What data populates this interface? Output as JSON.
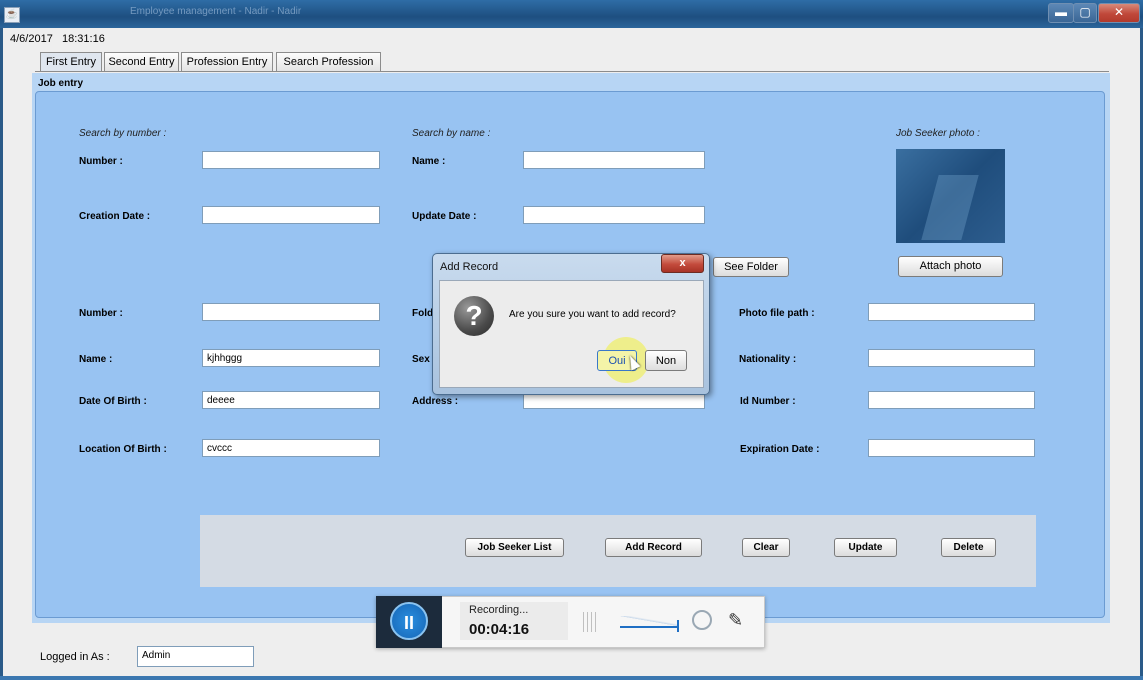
{
  "window": {
    "title": "Employee management - Nadir - Nadir",
    "controls": {
      "minimize": "▬",
      "maximize": "▢",
      "close": "✕"
    }
  },
  "status": {
    "datetime": "4/6/2017   18:31:16"
  },
  "tabs": [
    {
      "label": "First Entry",
      "active": true
    },
    {
      "label": "Second Entry",
      "active": false
    },
    {
      "label": "Profession Entry",
      "active": false
    },
    {
      "label": "Search Profession",
      "active": false
    }
  ],
  "panel": {
    "title": "Job entry"
  },
  "sections": {
    "by_number": "Search by number :",
    "by_name": "Search by name :",
    "photo": "Job Seeker photo :"
  },
  "labels": {
    "number_search": "Number :",
    "name_search": "Name :",
    "creation_date": "Creation Date :",
    "update_date": "Update Date :",
    "number": "Number :",
    "folder": "Fold",
    "photo_path": "Photo file path :",
    "name": "Name :",
    "sex": "Sex",
    "nationality": "Nationality :",
    "dob": "Date Of Birth :",
    "address": "Address :",
    "id_number": "Id Number :",
    "location_birth": "Location Of Birth :",
    "expiration": "Expiration Date :"
  },
  "fields": {
    "number_search": "",
    "name_search": "",
    "creation_date": "",
    "update_date": "",
    "number": "",
    "photo_path": "",
    "name": "kjhhggg",
    "nationality": "",
    "dob": "deeee",
    "address": "",
    "id_number": "",
    "location_birth": "cvccc",
    "expiration": ""
  },
  "buttons": {
    "see_folder": "See Folder",
    "attach_photo": "Attach photo",
    "job_seeker_list": "Job Seeker List",
    "add_record": "Add Record",
    "clear": "Clear",
    "update": "Update",
    "delete": "Delete"
  },
  "dialog": {
    "title": "Add Record",
    "close": "x",
    "icon": "?",
    "message": "Are you sure you want to add record?",
    "yes": "Oui",
    "no": "Non"
  },
  "recorder": {
    "status": "Recording...",
    "time": "00:04:16",
    "pause_icon": "II"
  },
  "footer": {
    "logged_label": "Logged in As :",
    "user": "Admin"
  },
  "icons": {
    "pause": "pause-icon",
    "webcam": "webcam-icon",
    "pencil": "pencil-icon",
    "question": "question-icon"
  }
}
